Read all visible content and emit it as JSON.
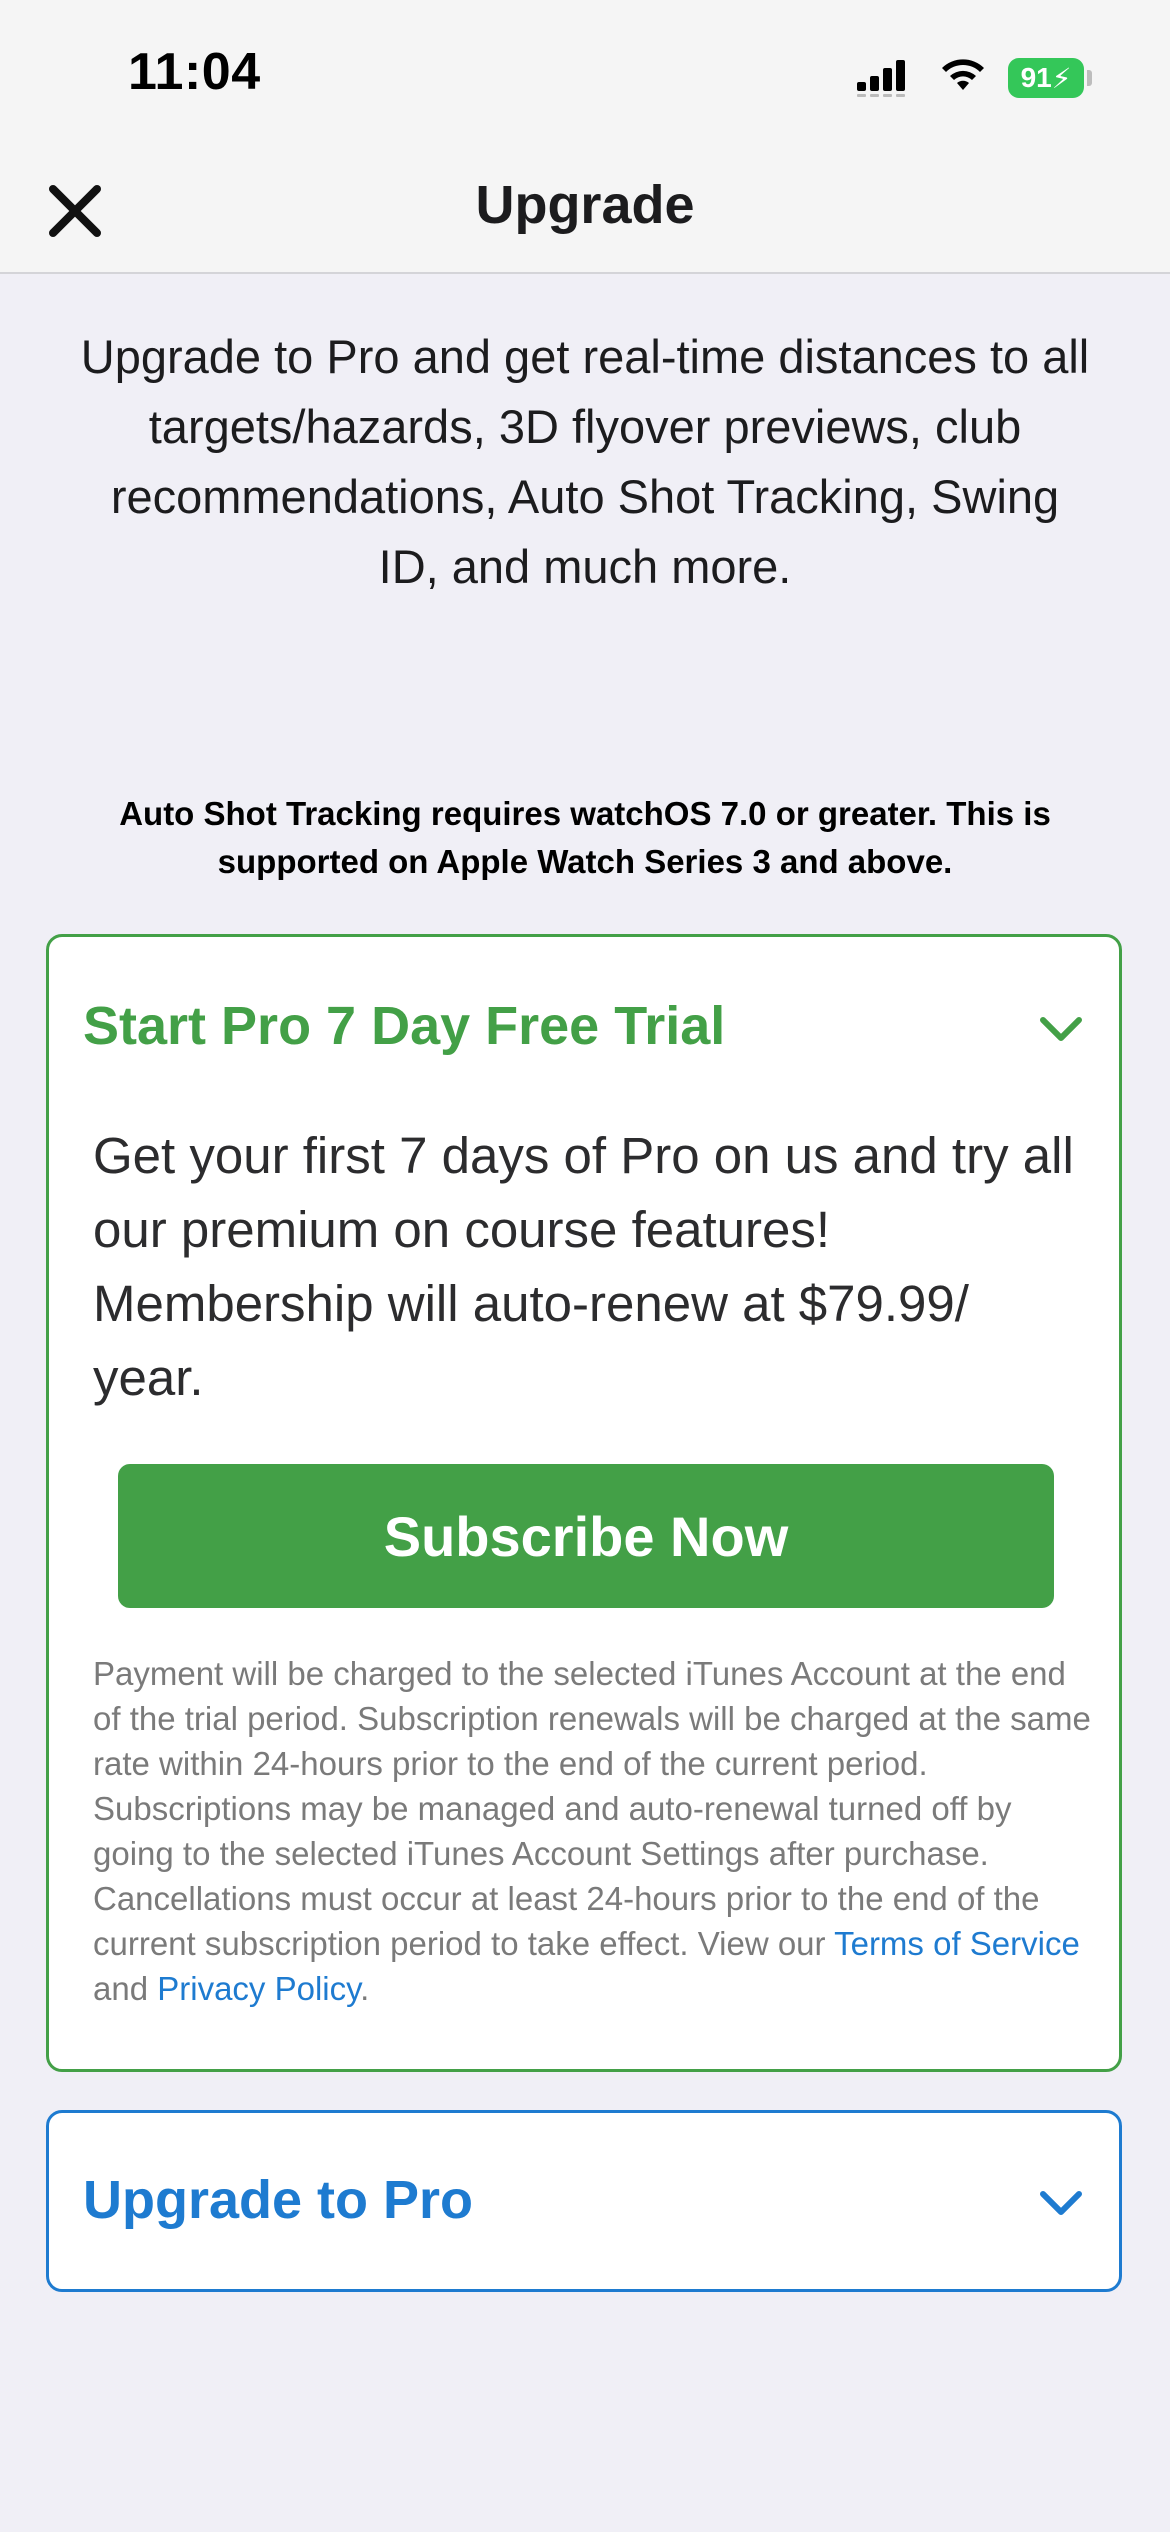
{
  "status_bar": {
    "time": "11:04",
    "battery": "91",
    "icons": [
      "signal-icon",
      "wifi-icon",
      "battery-icon"
    ]
  },
  "nav": {
    "title": "Upgrade",
    "close_icon": "close-icon"
  },
  "intro": {
    "text": "Upgrade to Pro and get real-time distances to all targets/hazards, 3D flyover previews, club recommendations, Auto Shot Tracking, Swing ID, and much more."
  },
  "requirement_note": "Auto Shot Tracking requires watchOS 7.0 or greater. This is supported on Apple Watch Series 3 and above.",
  "trial_card": {
    "title": "Start Pro 7 Day Free Trial",
    "description": "Get your first 7 days of Pro on us and try all our premium on course features! Membership will auto-renew at $79.99/ year.",
    "subscribe_label": "Subscribe Now",
    "legal_text": "Payment will be charged to the selected iTunes Account at the end of the trial period. Subscription renewals will be charged at the same rate within 24-hours prior to the end of the current period. Subscriptions may be managed and auto-renewal turned off by going to the selected iTunes Account Settings after purchase. Cancellations must occur at least 24-hours prior to the end of the current subscription period to take effect. View our",
    "terms_link": "Terms of Service",
    "and_text": "and",
    "privacy_link": "Privacy Policy",
    "end_punct": ".",
    "accent_color": "#43a047",
    "chevron_icon": "chevron-down-icon"
  },
  "pro_card": {
    "title": "Upgrade to Pro",
    "accent_color": "#1e7bd0",
    "chevron_icon": "chevron-down-icon"
  }
}
